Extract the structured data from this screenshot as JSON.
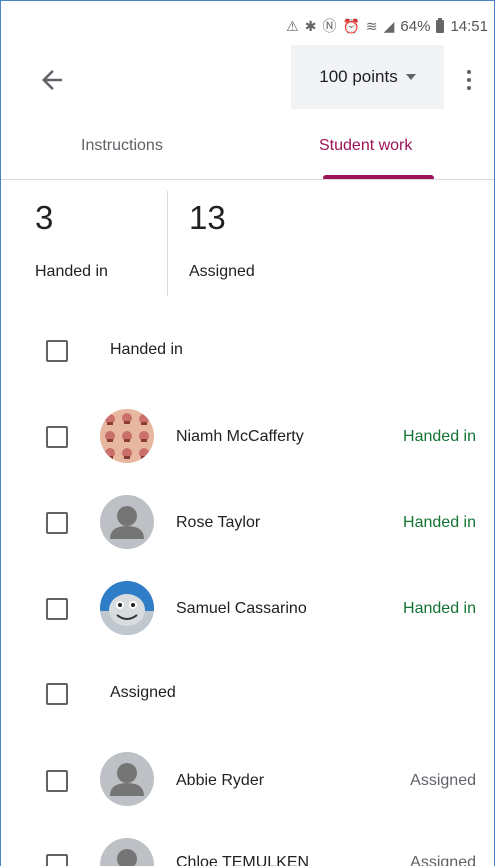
{
  "status_bar": {
    "icons": [
      "alert-icon",
      "bluetooth-icon",
      "nfc-icon",
      "alarm-icon",
      "wifi-icon",
      "signal-icon",
      "battery-icon"
    ],
    "battery": "64%",
    "time": "14:51"
  },
  "header": {
    "points": "100 points"
  },
  "tabs": [
    {
      "label": "Instructions",
      "active": false
    },
    {
      "label": "Student work",
      "active": true
    }
  ],
  "stats": [
    {
      "value": "3",
      "label": "Handed in"
    },
    {
      "value": "13",
      "label": "Assigned"
    }
  ],
  "groups": {
    "handed_in": {
      "label": "Handed in",
      "students": [
        {
          "name": "Niamh McCafferty",
          "status": "Handed in"
        },
        {
          "name": "Rose Taylor",
          "status": "Handed in"
        },
        {
          "name": "Samuel Cassarino",
          "status": "Handed in"
        }
      ]
    },
    "assigned": {
      "label": "Assigned",
      "students": [
        {
          "name": "Abbie Ryder",
          "status": "Assigned"
        },
        {
          "name": "Chloe TEMULKEN",
          "status": "Assigned"
        }
      ]
    }
  },
  "colors": {
    "accent": "#9c1458",
    "handed_in": "#137333",
    "assigned": "#5f6368",
    "frame": "#4a86c5"
  }
}
